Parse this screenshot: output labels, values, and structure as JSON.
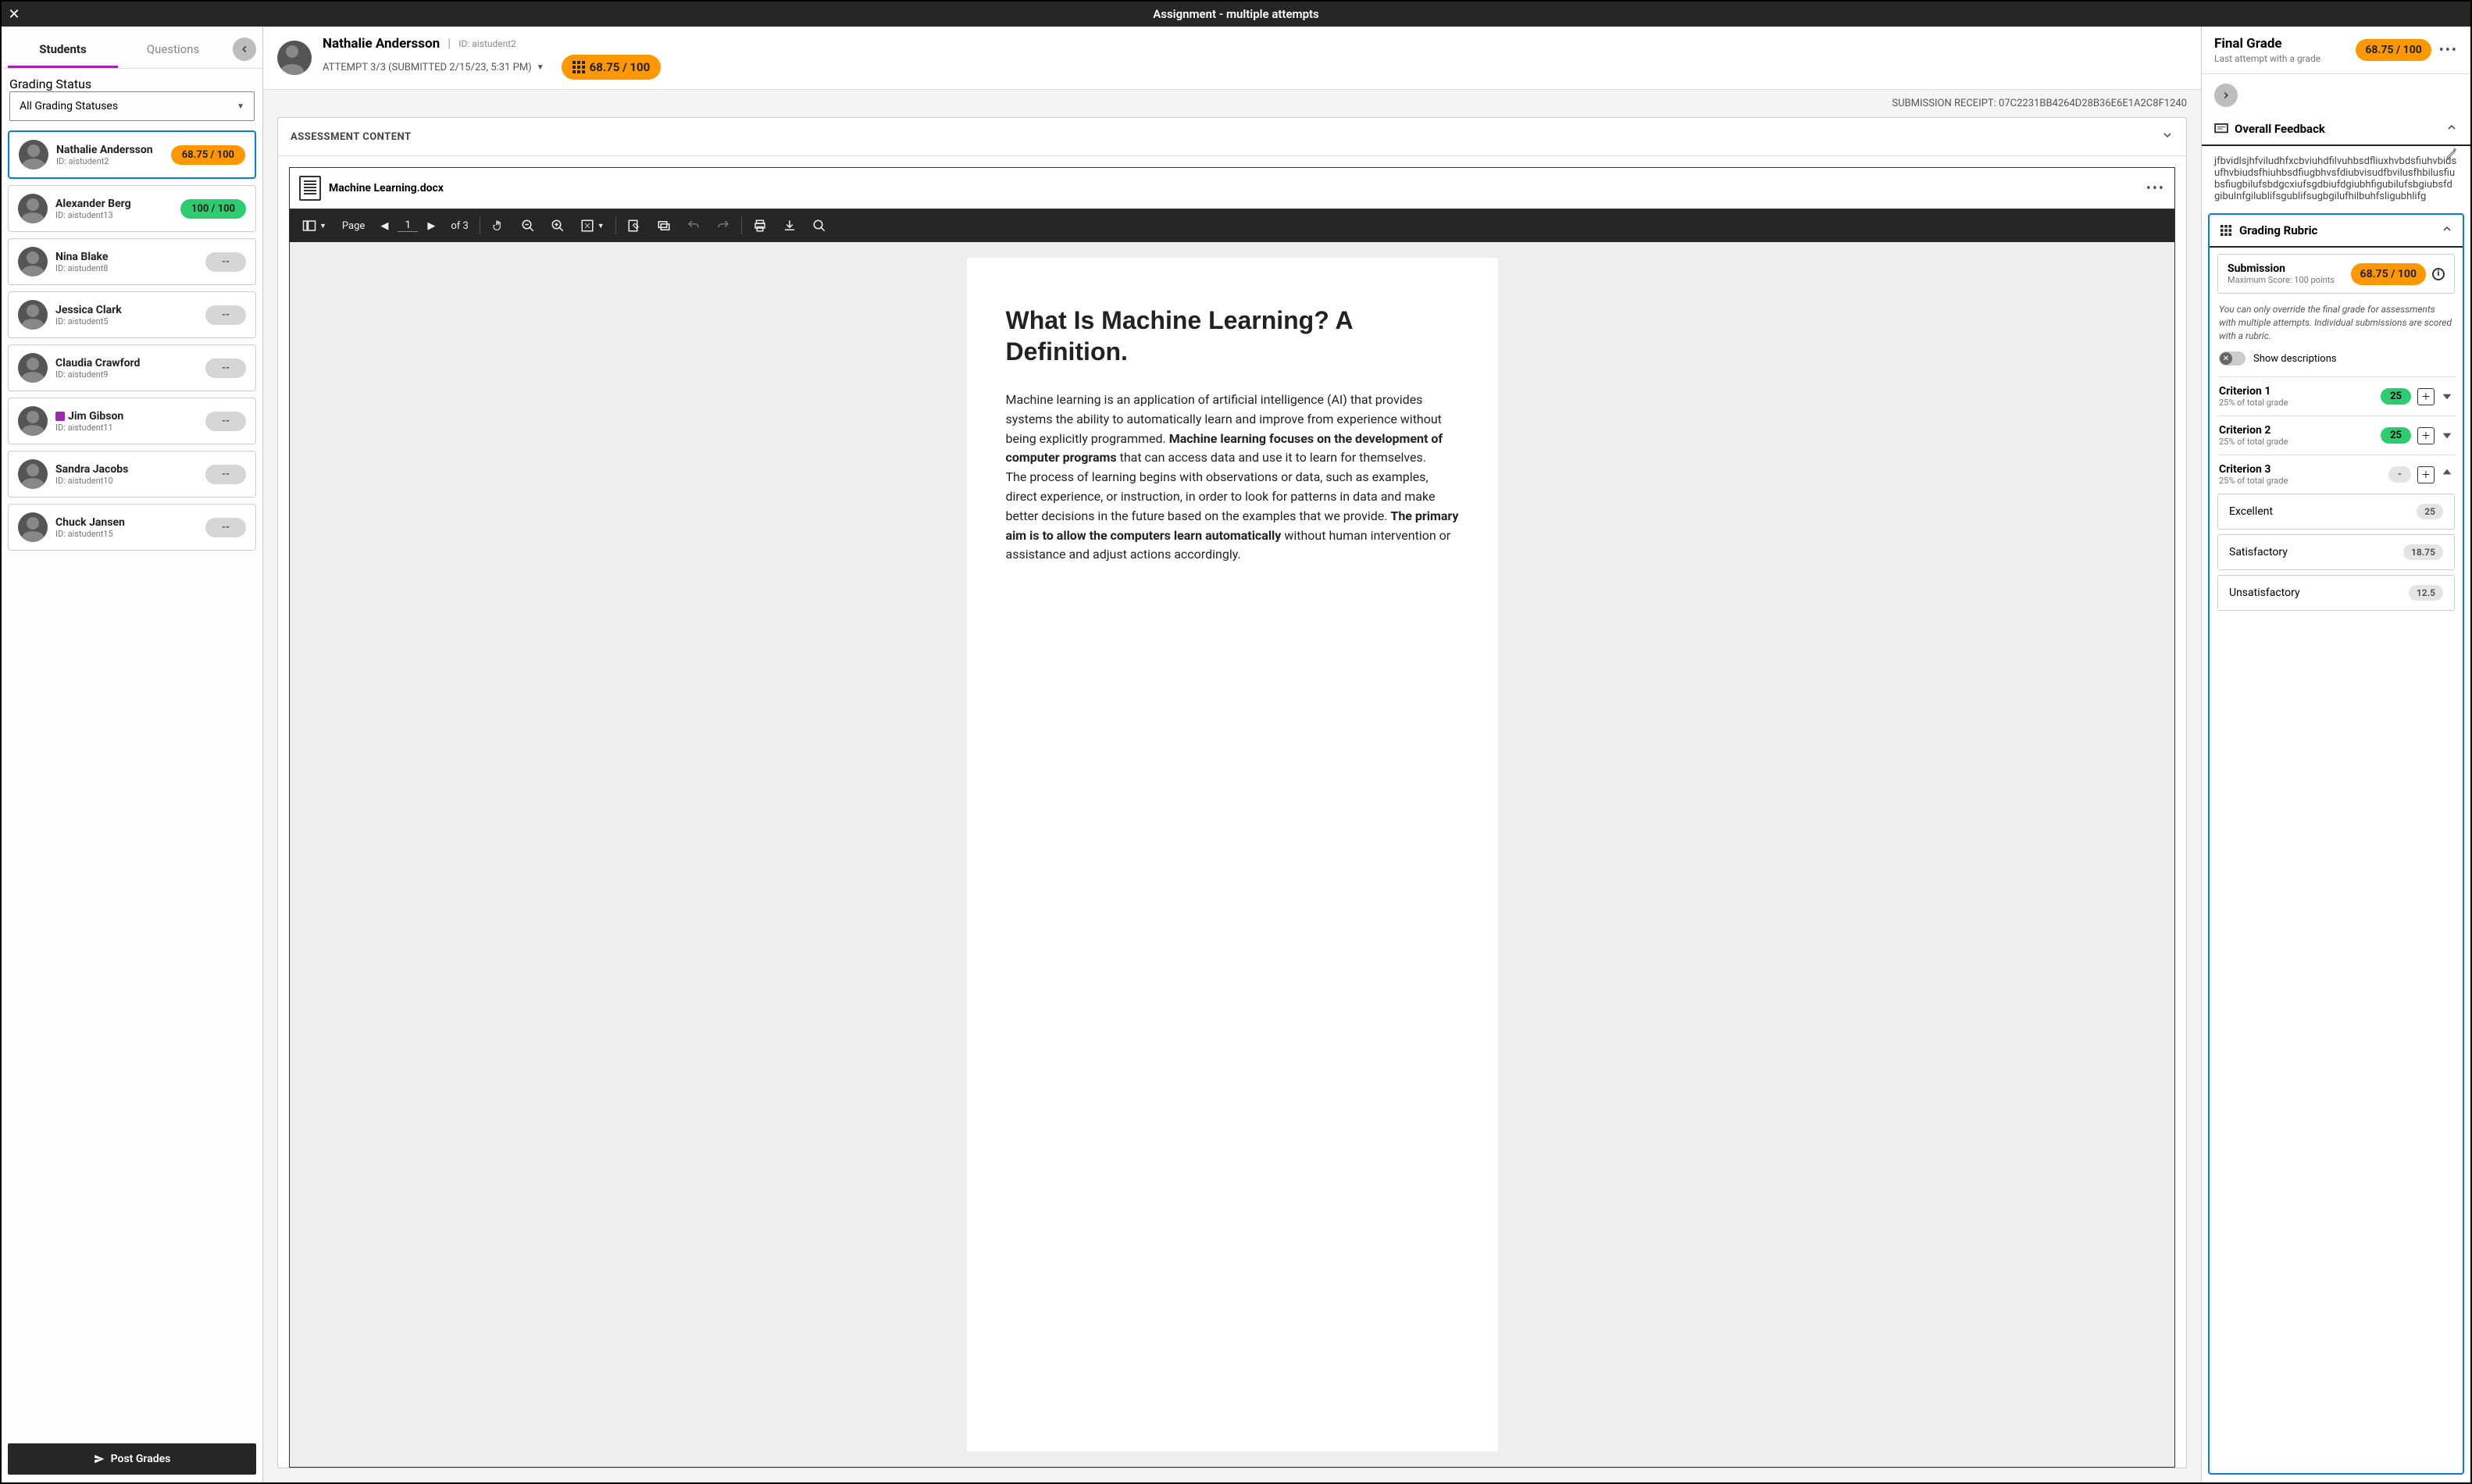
{
  "window_title": "Assignment - multiple attempts",
  "tabs": {
    "students": "Students",
    "questions": "Questions"
  },
  "filter": {
    "legend": "Grading Status",
    "value": "All Grading Statuses"
  },
  "students": [
    {
      "name": "Nathalie Andersson",
      "id": "ID: aistudent2",
      "grade": "68.75 / 100",
      "pill": "orange",
      "selected": true
    },
    {
      "name": "Alexander Berg",
      "id": "ID: aistudent13",
      "grade": "100 / 100",
      "pill": "green"
    },
    {
      "name": "Nina Blake",
      "id": "ID: aistudent8",
      "grade": "--",
      "pill": "grey"
    },
    {
      "name": "Jessica Clark",
      "id": "ID: aistudent5",
      "grade": "--",
      "pill": "grey"
    },
    {
      "name": "Claudia Crawford",
      "id": "ID: aistudent9",
      "grade": "--",
      "pill": "grey"
    },
    {
      "name": "Jim Gibson",
      "id": "ID: aistudent11",
      "grade": "--",
      "pill": "grey",
      "accom": true
    },
    {
      "name": "Sandra Jacobs",
      "id": "ID: aistudent10",
      "grade": "--",
      "pill": "grey"
    },
    {
      "name": "Chuck Jansen",
      "id": "ID: aistudent15",
      "grade": "--",
      "pill": "grey"
    }
  ],
  "post_grades": "Post Grades",
  "center": {
    "student_name": "Nathalie Andersson",
    "student_id": "ID: aistudent2",
    "attempt": "ATTEMPT 3/3 (SUBMITTED 2/15/23, 5:31 PM)",
    "score": "68.75 / 100",
    "receipt": "SUBMISSION RECEIPT: 07C2231BB4264D28B36E6E1A2C8F1240",
    "assessment_label": "ASSESSMENT CONTENT",
    "doc_name": "Machine Learning.docx",
    "page_label": "Page",
    "page_current": "1",
    "page_total": "of 3",
    "doc_heading": "What Is Machine Learning? A Definition.",
    "doc_body_html": "Machine learning is an application of artificial intelligence (AI) that provides systems the ability to automatically learn and improve from experience without being explicitly programmed. <b>Machine learning focuses on the development of computer programs</b> that can access data and use it to learn for themselves.<br>The process of learning begins with observations or data, such as examples, direct experience, or instruction, in order to look for patterns in data and make better decisions in the future based on the examples that we provide. <b>The primary aim is to allow the computers learn automatically</b> without human intervention or assistance and adjust actions accordingly."
  },
  "right": {
    "final_grade_label": "Final Grade",
    "final_grade_sub": "Last attempt with a grade",
    "final_grade_value": "68.75 / 100",
    "overall_feedback_label": "Overall Feedback",
    "feedback_text": "jfbvidlsjhfviludhfxcbviuhdfilvuhbsdfliuxhvbdsfiuhvbidsufhvbiudsfhiuhbsdfiugbhvsfdiubvisudfbvilusfhbilusfiubsfiugbilufsbdgcxiufsgdbiufdgiubhfigubilufsbgiubsfdgibulnfgilublifsgublifsugbgilufhilbuhfsligubhlifg",
    "rubric_label": "Grading Rubric",
    "submission_label": "Submission",
    "submission_sub": "Maximum Score: 100 points",
    "submission_score": "68.75 / 100",
    "rubric_note": "You can only override the final grade for assessments with multiple attempts. Individual submissions are scored with a rubric.",
    "show_desc": "Show descriptions",
    "criteria": [
      {
        "name": "Criterion 1",
        "sub": "25% of total grade",
        "val": "25",
        "pill": "green",
        "arrow": "down"
      },
      {
        "name": "Criterion 2",
        "sub": "25% of total grade",
        "val": "25",
        "pill": "green",
        "arrow": "down"
      },
      {
        "name": "Criterion 3",
        "sub": "25% of total grade",
        "val": "-",
        "pill": "grey",
        "arrow": "up"
      }
    ],
    "levels": [
      {
        "name": "Excellent",
        "val": "25"
      },
      {
        "name": "Satisfactory",
        "val": "18.75"
      },
      {
        "name": "Unsatisfactory",
        "val": "12.5"
      }
    ]
  }
}
